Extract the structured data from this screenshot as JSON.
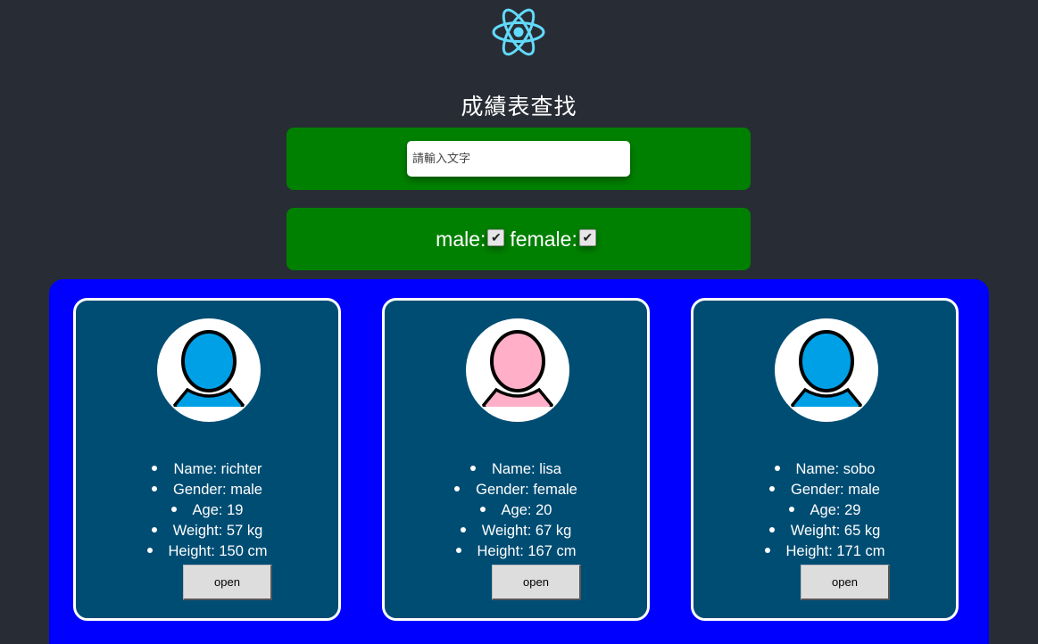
{
  "header": {
    "logo_icon": "react-atom-icon",
    "title": "成績表查找"
  },
  "search": {
    "placeholder": "請輸入文字",
    "value": ""
  },
  "filters": {
    "male_label": "male:",
    "male_checked": true,
    "female_label": "female:",
    "female_checked": true
  },
  "colors": {
    "background": "#282c34",
    "filter_panel": "#008000",
    "cards_panel": "#0000ff",
    "card_bg": "#004d73",
    "male_avatar": "#00a0e6",
    "female_avatar": "#ffb0c8"
  },
  "cards": [
    {
      "avatar": "male-avatar-icon",
      "name": "Name: richter",
      "gender": "Gender: male",
      "age": "Age: 19",
      "weight": "Weight: 57 kg",
      "height": "Height: 150 cm",
      "button": "open"
    },
    {
      "avatar": "female-avatar-icon",
      "name": "Name: lisa",
      "gender": "Gender: female",
      "age": "Age: 20",
      "weight": "Weight: 67 kg",
      "height": "Height: 167 cm",
      "button": "open"
    },
    {
      "avatar": "male-avatar-icon",
      "name": "Name: sobo",
      "gender": "Gender: male",
      "age": "Age: 29",
      "weight": "Weight: 65 kg",
      "height": "Height: 171 cm",
      "button": "open"
    }
  ]
}
